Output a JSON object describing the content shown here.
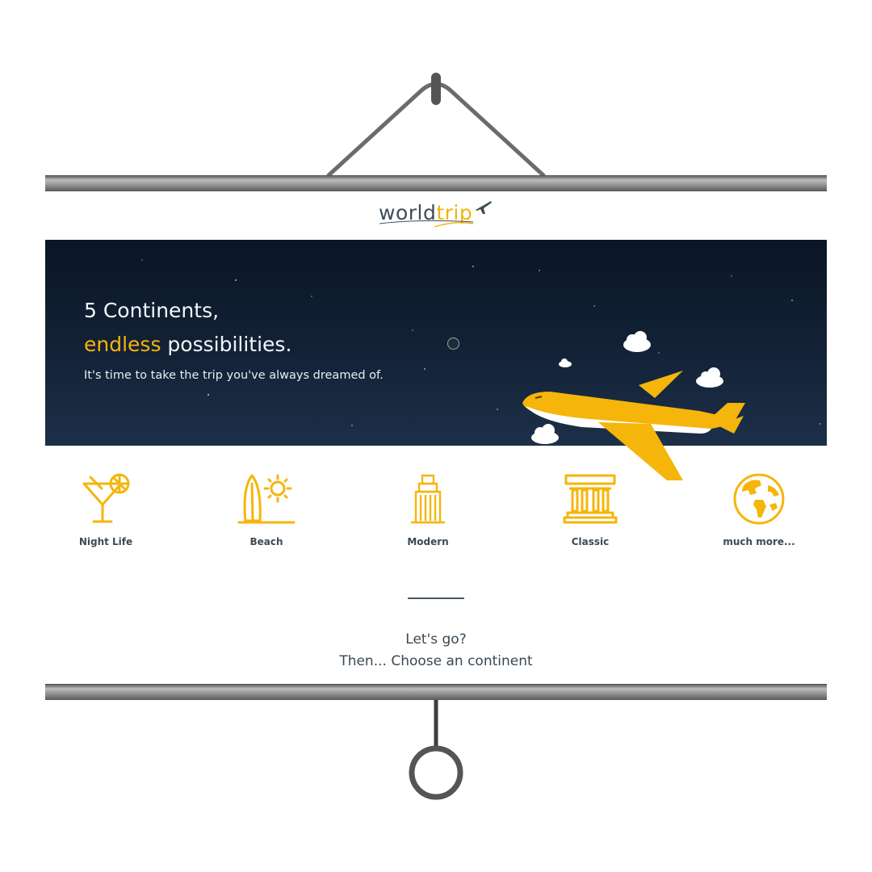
{
  "logo": {
    "word1": "world",
    "word2": "trip"
  },
  "hero": {
    "headline_line1": "5 Continents,",
    "headline_highlight": "endless",
    "headline_rest": " possibilities.",
    "subtitle": "It's time to take the trip you've always dreamed of."
  },
  "categories": [
    {
      "label": "Night Life",
      "icon": "cocktail-icon"
    },
    {
      "label": "Beach",
      "icon": "surfboard-sun-icon"
    },
    {
      "label": "Modern",
      "icon": "skyscraper-icon"
    },
    {
      "label": "Classic",
      "icon": "classical-building-icon"
    },
    {
      "label": "much more...",
      "icon": "globe-icon"
    }
  ],
  "cta": {
    "line1": "Let's go?",
    "line2": "Then... Choose an continent"
  },
  "colors": {
    "accent": "#f5b50b",
    "text_dark": "#3d4a54",
    "banner_bg": "#0f1c2e",
    "rod": "#8a8a8a"
  }
}
